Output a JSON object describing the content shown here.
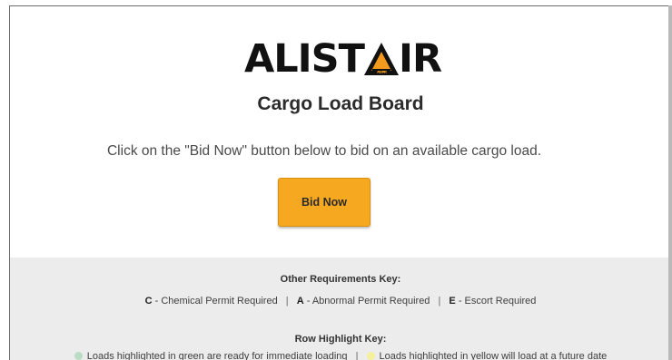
{
  "logo": {
    "text_left": "ALIST",
    "text_right": "IR",
    "badge_text": "ALISTAIR"
  },
  "page": {
    "title": "Cargo Load Board",
    "instructions": "Click on the \"Bid Now\" button below to bid on an available cargo load.",
    "bid_button": "Bid Now"
  },
  "requirements_key": {
    "heading": "Other Requirements Key:",
    "items": [
      {
        "code": "C",
        "desc": "- Chemical Permit Required"
      },
      {
        "code": "A",
        "desc": "- Abnormal Permit Required"
      },
      {
        "code": "E",
        "desc": "- Escort Required"
      }
    ],
    "separator": "|"
  },
  "highlight_key": {
    "heading": "Row Highlight Key:",
    "items": [
      {
        "text": "Loads highlighted in green are ready for immediate loading",
        "color": "#b9dcc4"
      },
      {
        "text": "Loads highlighted in yellow will load at a future date",
        "color": "#f5f09a"
      }
    ],
    "separator": "|"
  },
  "colors": {
    "accent": "#f6a820",
    "key_background": "#ececec",
    "logo_orange": "#f39a1d"
  }
}
